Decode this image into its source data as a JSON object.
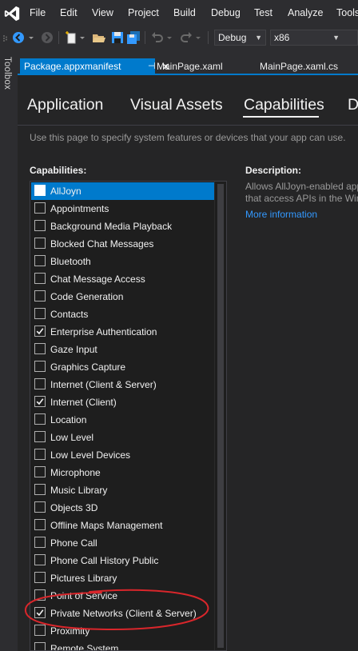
{
  "menu": [
    "File",
    "Edit",
    "View",
    "Project",
    "Build",
    "Debug",
    "Test",
    "Analyze",
    "Tools"
  ],
  "toolbar": {
    "config_value": "Debug",
    "platform_value": "x86",
    "icons": [
      "back-icon",
      "forward-icon",
      "new-project-icon",
      "open-folder-icon",
      "save-icon",
      "save-all-icon",
      "undo-icon",
      "redo-icon"
    ]
  },
  "toolbox_label": "Toolbox",
  "doc_tabs": [
    {
      "label": "Package.appxmanifest",
      "active": true
    },
    {
      "label": "MainPage.xaml",
      "active": false
    },
    {
      "label": "MainPage.xaml.cs",
      "active": false
    }
  ],
  "tab_pin_glyph": "⊣",
  "tab_close_glyph": "✕",
  "page_tabs": [
    "Application",
    "Visual Assets",
    "Capabilities",
    "D"
  ],
  "active_page_tab": "Capabilities",
  "hint": "Use this page to specify system features or devices that your app can use.",
  "capabilities_label": "Capabilities:",
  "description_label": "Description:",
  "description_lines": [
    "Allows AllJoyn-enabled app",
    "that access APIs in the Win"
  ],
  "more_info": "More information",
  "capabilities": [
    {
      "label": "AllJoyn",
      "checked": false,
      "selected": true
    },
    {
      "label": "Appointments",
      "checked": false
    },
    {
      "label": "Background Media Playback",
      "checked": false
    },
    {
      "label": "Blocked Chat Messages",
      "checked": false
    },
    {
      "label": "Bluetooth",
      "checked": false
    },
    {
      "label": "Chat Message Access",
      "checked": false
    },
    {
      "label": "Code Generation",
      "checked": false
    },
    {
      "label": "Contacts",
      "checked": false
    },
    {
      "label": "Enterprise Authentication",
      "checked": true
    },
    {
      "label": "Gaze Input",
      "checked": false
    },
    {
      "label": "Graphics Capture",
      "checked": false
    },
    {
      "label": "Internet (Client & Server)",
      "checked": false
    },
    {
      "label": "Internet (Client)",
      "checked": true
    },
    {
      "label": "Location",
      "checked": false
    },
    {
      "label": "Low Level",
      "checked": false
    },
    {
      "label": "Low Level Devices",
      "checked": false
    },
    {
      "label": "Microphone",
      "checked": false
    },
    {
      "label": "Music Library",
      "checked": false
    },
    {
      "label": "Objects 3D",
      "checked": false
    },
    {
      "label": "Offline Maps Management",
      "checked": false
    },
    {
      "label": "Phone Call",
      "checked": false
    },
    {
      "label": "Phone Call History Public",
      "checked": false
    },
    {
      "label": "Pictures Library",
      "checked": false
    },
    {
      "label": "Point of Service",
      "checked": false
    },
    {
      "label": "Private Networks (Client & Server)",
      "checked": true,
      "annotated": true
    },
    {
      "label": "Proximity",
      "checked": false
    },
    {
      "label": "Remote System",
      "checked": false
    }
  ],
  "colors": {
    "accent": "#007acc",
    "annotation": "#d9262b",
    "link": "#3399ff"
  }
}
